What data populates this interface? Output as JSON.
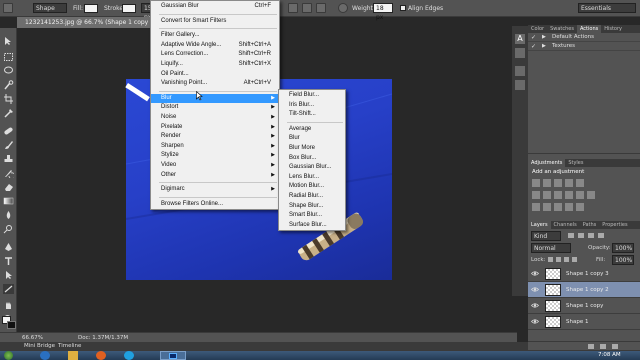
{
  "options_bar": {
    "shape_mode": "Shape",
    "fill_label": "Fill:",
    "stroke_label": "Stroke:",
    "stroke_size": "15 px",
    "weight_label": "Weight:",
    "weight_value": "18 px",
    "align_edges": "Align Edges",
    "workspace": "Essentials"
  },
  "document_tab": "1232141253.jpg @ 66.7% (Shape 1 copy 2, RGB/",
  "filter_menu": {
    "items": [
      {
        "label": "Gaussian Blur",
        "shortcut": "Ctrl+F"
      },
      {
        "separator": true
      },
      {
        "label": "Convert for Smart Filters"
      },
      {
        "separator": true
      },
      {
        "label": "Filter Gallery..."
      },
      {
        "label": "Adaptive Wide Angle...",
        "shortcut": "Shift+Ctrl+A"
      },
      {
        "label": "Lens Correction...",
        "shortcut": "Shift+Ctrl+R"
      },
      {
        "label": "Liquify...",
        "shortcut": "Shift+Ctrl+X"
      },
      {
        "label": "Oil Paint..."
      },
      {
        "label": "Vanishing Point...",
        "shortcut": "Alt+Ctrl+V"
      },
      {
        "separator": true
      },
      {
        "label": "Blur",
        "submenu": true,
        "highlighted": true
      },
      {
        "label": "Distort",
        "submenu": true
      },
      {
        "label": "Noise",
        "submenu": true
      },
      {
        "label": "Pixelate",
        "submenu": true
      },
      {
        "label": "Render",
        "submenu": true
      },
      {
        "label": "Sharpen",
        "submenu": true
      },
      {
        "label": "Stylize",
        "submenu": true
      },
      {
        "label": "Video",
        "submenu": true
      },
      {
        "label": "Other",
        "submenu": true
      },
      {
        "separator": true
      },
      {
        "label": "Digimarc",
        "submenu": true
      },
      {
        "separator": true
      },
      {
        "label": "Browse Filters Online..."
      }
    ]
  },
  "blur_submenu": {
    "items": [
      {
        "label": "Field Blur..."
      },
      {
        "label": "Iris Blur..."
      },
      {
        "label": "Tilt-Shift..."
      },
      {
        "separator": true
      },
      {
        "label": "Average"
      },
      {
        "label": "Blur"
      },
      {
        "label": "Blur More"
      },
      {
        "label": "Box Blur..."
      },
      {
        "label": "Gaussian Blur..."
      },
      {
        "label": "Lens Blur..."
      },
      {
        "label": "Motion Blur..."
      },
      {
        "label": "Radial Blur..."
      },
      {
        "label": "Shape Blur..."
      },
      {
        "label": "Smart Blur..."
      },
      {
        "label": "Surface Blur..."
      }
    ]
  },
  "panels": {
    "top_tabs": [
      "Color",
      "Swatches",
      "Actions",
      "History"
    ],
    "active_top_tab": "Actions",
    "actions": [
      "Default Actions",
      "Textures"
    ],
    "adj_tabs": [
      "Adjustments",
      "Styles"
    ],
    "add_adjustment": "Add an adjustment",
    "layer_tabs": [
      "Layers",
      "Channels",
      "Paths",
      "Properties"
    ],
    "kind_label": "Kind",
    "blend_mode": "Normal",
    "opacity_label": "Opacity:",
    "opacity_value": "100%",
    "lock_label": "Lock:",
    "fill_label": "Fill:",
    "fill_value": "100%",
    "layers": [
      {
        "name": "Shape 1 copy 3",
        "selected": false
      },
      {
        "name": "Shape 1 copy 2",
        "selected": true
      },
      {
        "name": "Shape 1 copy",
        "selected": false
      },
      {
        "name": "Shape 1",
        "selected": false
      }
    ]
  },
  "status_bar": {
    "zoom": "66.67%",
    "doc": "Doc: 1.37M/1.37M"
  },
  "bottom_tabs": [
    "Mini Bridge",
    "Timeline"
  ],
  "taskbar": {
    "clock": "7:08 AM"
  }
}
